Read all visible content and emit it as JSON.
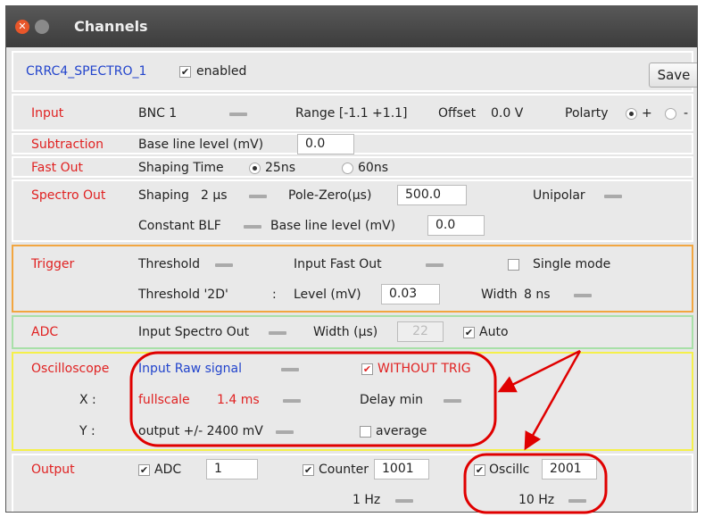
{
  "window": {
    "title": "Channels"
  },
  "channel": {
    "name": "CRRC4_SPECTRO_1",
    "enabled_label": "enabled",
    "enabled_check": "✔",
    "save_label": "Save"
  },
  "input": {
    "label": "Input",
    "source": "BNC 1",
    "range": "Range [-1.1 +1.1]",
    "offset": "Offset",
    "offset_value": "0.0 V",
    "polarity": "Polarty",
    "plus": "+",
    "minus": "-"
  },
  "subtraction": {
    "label": "Subtraction",
    "baseline_label": "Base line level (mV)",
    "baseline_value": "0.0"
  },
  "fastout": {
    "label": "Fast Out",
    "shaping_label": "Shaping Time",
    "opt1": "25ns",
    "opt2": "60ns"
  },
  "spectro": {
    "label": "Spectro Out",
    "shaping_label": "Shaping",
    "shaping_value": "2 µs",
    "polezero_label": "Pole-Zero(µs)",
    "polezero_value": "500.0",
    "mode": "Unipolar",
    "blf_label": "Constant BLF",
    "baseline_label": "Base line level (mV)",
    "baseline_value": "0.0"
  },
  "trigger": {
    "label": "Trigger",
    "threshold_label": "Threshold",
    "source": "Input Fast Out",
    "single_label": "Single mode",
    "threshold2d": "Threshold '2D'",
    "colon": ":",
    "level_label": "Level (mV)",
    "level_value": "0.03",
    "width_label": "Width",
    "width_value": "8 ns"
  },
  "adc": {
    "label": "ADC",
    "input": "Input Spectro Out",
    "width_label": "Width (µs)",
    "width_value": "22",
    "auto_label": "Auto",
    "auto_check": "✔"
  },
  "osc": {
    "label": "Oscilloscope",
    "input": "Input Raw signal",
    "without_trig": "WITHOUT TRIG",
    "without_check": "✔",
    "x_label": "X :",
    "fullscale": "fullscale",
    "fullscale_value": "1.4 ms",
    "delay": "Delay min",
    "y_label": "Y :",
    "output": "output +/- 2400 mV",
    "average": "average"
  },
  "output": {
    "label": "Output",
    "adc_label": "ADC",
    "adc_check": "✔",
    "adc_value": "1",
    "counter_label": "Counter",
    "counter_check": "✔",
    "counter_value": "1001",
    "counter_rate": "1 Hz",
    "oscillo_label": "Oscillc",
    "oscillo_check": "✔",
    "oscillo_value": "2001",
    "oscillo_rate": "10 Hz"
  },
  "colors": {
    "label_red": "#e02222",
    "link_blue": "#2244cc",
    "trigger_border": "#f2a640",
    "adc_border": "#a8e0a8",
    "osc_border": "#f5f04a",
    "annotation": "#e00000"
  }
}
